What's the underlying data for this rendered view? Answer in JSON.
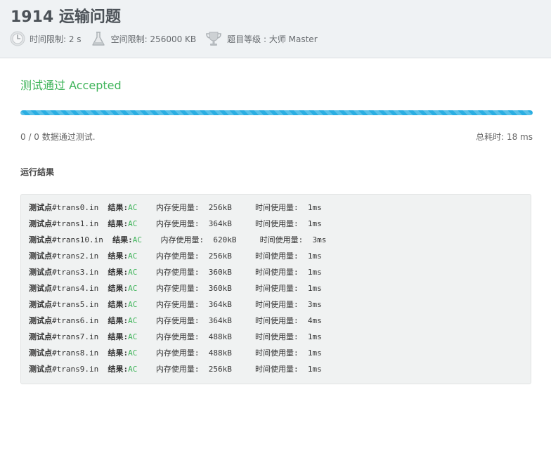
{
  "problem": {
    "title": "1914 运输问题",
    "time_limit": "时间限制: 2 s",
    "memory_limit": "空间限制: 256000 KB",
    "level": "题目等级 : 大师 Master"
  },
  "icons": {
    "time": "clock-icon",
    "memory": "flask-icon",
    "level": "trophy-icon"
  },
  "colors": {
    "accepted": "#3fb45a",
    "progress": "#2aaee2"
  },
  "result": {
    "status": "测试通过 Accepted",
    "progress_fraction": 1.0,
    "passed_summary": "0 / 0 数据通过测试.",
    "total_time": "总耗时: 18 ms"
  },
  "run_results": {
    "title": "运行结果",
    "test_point_label": "测试点",
    "result_label": "结果:",
    "memory_label": "内存使用量:",
    "time_label": "时间使用量:",
    "rows": [
      {
        "file": "#trans0.in",
        "verdict": "AC",
        "memory": "256kB",
        "time": "1ms"
      },
      {
        "file": "#trans1.in",
        "verdict": "AC",
        "memory": "364kB",
        "time": "1ms"
      },
      {
        "file": "#trans10.in",
        "verdict": "AC",
        "memory": "620kB",
        "time": "3ms"
      },
      {
        "file": "#trans2.in",
        "verdict": "AC",
        "memory": "256kB",
        "time": "1ms"
      },
      {
        "file": "#trans3.in",
        "verdict": "AC",
        "memory": "360kB",
        "time": "1ms"
      },
      {
        "file": "#trans4.in",
        "verdict": "AC",
        "memory": "360kB",
        "time": "1ms"
      },
      {
        "file": "#trans5.in",
        "verdict": "AC",
        "memory": "364kB",
        "time": "3ms"
      },
      {
        "file": "#trans6.in",
        "verdict": "AC",
        "memory": "364kB",
        "time": "4ms"
      },
      {
        "file": "#trans7.in",
        "verdict": "AC",
        "memory": "488kB",
        "time": "1ms"
      },
      {
        "file": "#trans8.in",
        "verdict": "AC",
        "memory": "488kB",
        "time": "1ms"
      },
      {
        "file": "#trans9.in",
        "verdict": "AC",
        "memory": "256kB",
        "time": "1ms"
      }
    ]
  }
}
